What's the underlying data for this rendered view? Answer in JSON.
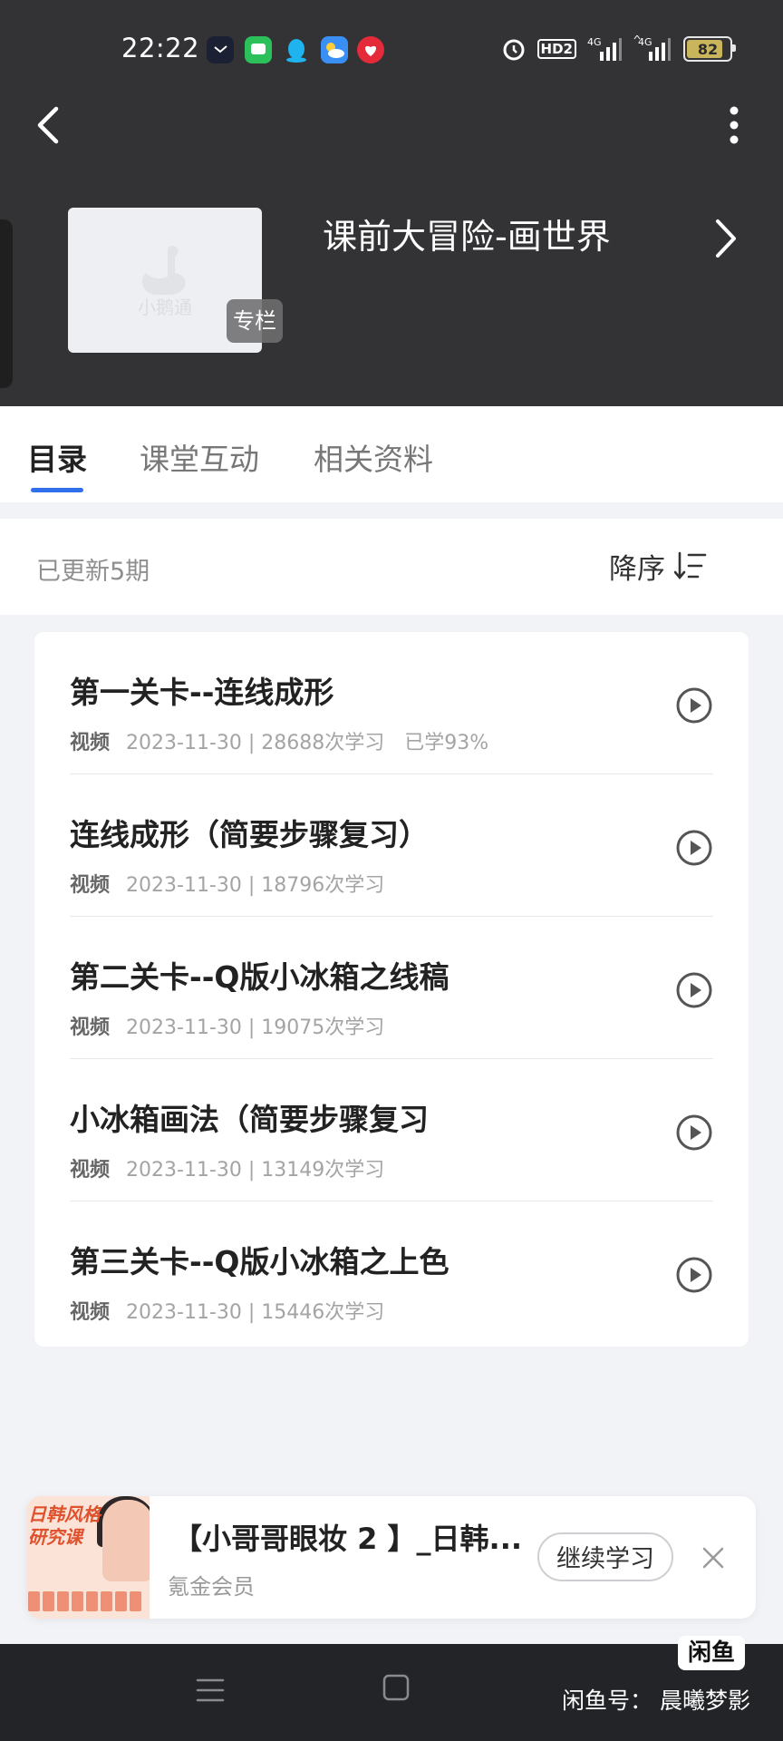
{
  "status_bar": {
    "time": "22:22",
    "battery": "82",
    "network": "4G",
    "hd_badge": "HD2",
    "icons": [
      "clock-app-icon",
      "messages-app-icon",
      "qq-app-icon",
      "weather-app-icon",
      "shop-app-icon",
      "alarm-icon",
      "signal-icon"
    ]
  },
  "header": {
    "course_title": "课前大冒险-画世界",
    "tag": "专栏",
    "cover_brand": "小鹅通"
  },
  "tabs": [
    {
      "label": "目录",
      "active": true
    },
    {
      "label": "课堂互动",
      "active": false
    },
    {
      "label": "相关资料",
      "active": false
    }
  ],
  "sort_bar": {
    "update_count": "已更新5期",
    "sort_label": "降序"
  },
  "lessons": [
    {
      "title": "第一关卡--连线成形",
      "type": "视频",
      "meta": "2023-11-30 | 28688次学习",
      "progress": "已学93%"
    },
    {
      "title": "连线成形（简要步骤复习）",
      "type": "视频",
      "meta": "2023-11-30 | 18796次学习",
      "progress": ""
    },
    {
      "title": "第二关卡--Q版小冰箱之线稿",
      "type": "视频",
      "meta": "2023-11-30 | 19075次学习",
      "progress": ""
    },
    {
      "title": "小冰箱画法（简要步骤复习",
      "type": "视频",
      "meta": "2023-11-30 | 13149次学习",
      "progress": ""
    },
    {
      "title": "第三关卡--Q版小冰箱之上色",
      "type": "视频",
      "meta": "2023-11-30 | 15446次学习",
      "progress": ""
    }
  ],
  "mini_player": {
    "title": "【小哥哥眼妆 2 】_日韩...",
    "subtitle": "氪金会员",
    "continue_label": "继续学习",
    "thumb_text_1": "日韩风格",
    "thumb_text_2": "研究课"
  },
  "watermark": {
    "logo": "闲鱼",
    "text": "闲鱼号：  晨曦梦影"
  },
  "colors": {
    "header_bg": "#333335",
    "accent": "#2f6fe9",
    "page_bg": "#f2f3f7",
    "navbar_bg": "#232427"
  }
}
